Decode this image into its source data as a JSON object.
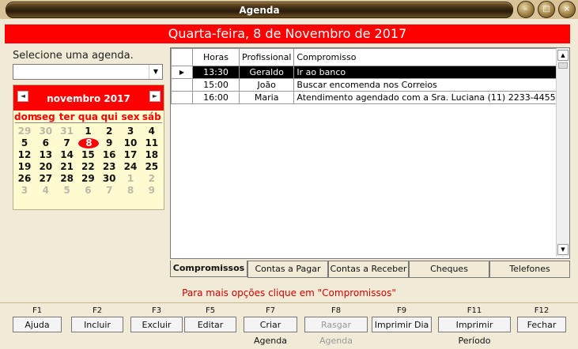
{
  "window": {
    "title": "Agenda"
  },
  "header": {
    "date_title": "Quarta-feira, 8 de Novembro de 2017"
  },
  "agenda_select": {
    "label": "Selecione uma agenda.",
    "value": ""
  },
  "calendar": {
    "month_label": "novembro 2017",
    "weekdays": [
      "dom",
      "seg",
      "ter",
      "qua",
      "qui",
      "sex",
      "sáb"
    ],
    "weeks": [
      [
        "29",
        "30",
        "31",
        "1",
        "2",
        "3",
        "4"
      ],
      [
        "5",
        "6",
        "7",
        "8",
        "9",
        "10",
        "11"
      ],
      [
        "12",
        "13",
        "14",
        "15",
        "16",
        "17",
        "18"
      ],
      [
        "19",
        "20",
        "21",
        "22",
        "23",
        "24",
        "25"
      ],
      [
        "26",
        "27",
        "28",
        "29",
        "30",
        "1",
        "2"
      ],
      [
        "3",
        "4",
        "5",
        "6",
        "7",
        "8",
        "9"
      ]
    ],
    "selected_day": "8"
  },
  "grid": {
    "columns": [
      "Horas",
      "Profissional",
      "Compromisso"
    ],
    "rows": [
      {
        "horas": "13:30",
        "profissional": "Geraldo",
        "compromisso": "Ir ao banco"
      },
      {
        "horas": "15:00",
        "profissional": "João",
        "compromisso": "Buscar encomenda nos Correios"
      },
      {
        "horas": "16:00",
        "profissional": "Maria",
        "compromisso": "Atendimento agendado com a Sra. Luciana (11) 2233-4455"
      }
    ]
  },
  "tabs": [
    "Compromissos",
    "Contas a Pagar",
    "Contas a Receber",
    "Cheques",
    "Telefones"
  ],
  "hint": "Para mais opções clique em \"Compromissos\"",
  "function_keys": [
    {
      "key": "F1",
      "label": "Ajuda"
    },
    {
      "key": "F2",
      "label": "Incluir"
    },
    {
      "key": "F3",
      "label": "Excluir"
    },
    {
      "key": "F5",
      "label": "Editar"
    },
    {
      "key": "F7",
      "label": "Criar Agenda"
    },
    {
      "key": "F8",
      "label": "Rasgar Agenda"
    },
    {
      "key": "F9",
      "label": "Imprimir Dia"
    },
    {
      "key": "F11",
      "label": "Imprimir Período"
    },
    {
      "key": "F12",
      "label": "Fechar"
    }
  ],
  "colors": {
    "accent": "#ff0000",
    "background": "#f1ead6",
    "calendar_bg": "#fffbd0"
  }
}
